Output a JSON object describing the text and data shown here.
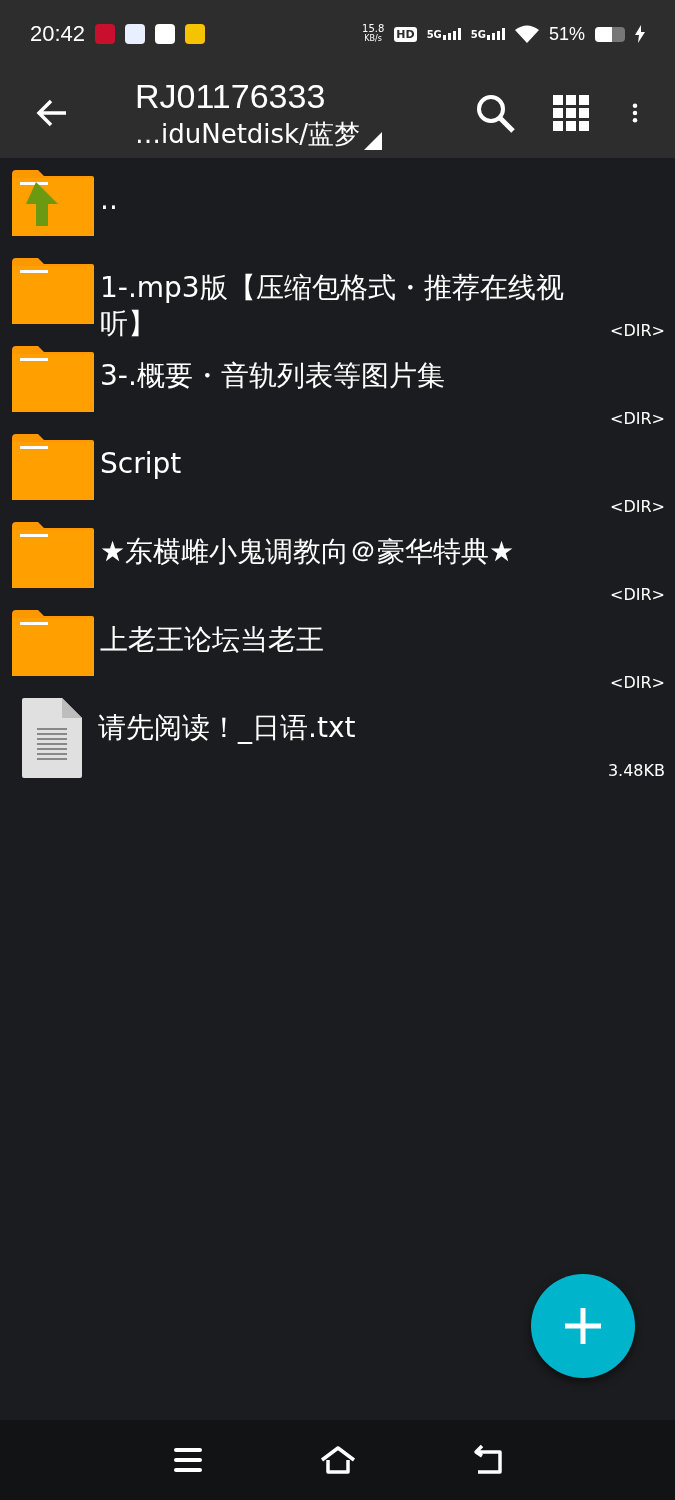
{
  "status_bar": {
    "time": "20:42",
    "net_speed": "15.8",
    "net_unit": "KB/s",
    "hd_label": "HD",
    "sim_labels": [
      "5G",
      "5G"
    ],
    "battery": "51%"
  },
  "toolbar": {
    "title": "RJ01176333",
    "path": "…iduNetdisk/蓝梦"
  },
  "files": [
    {
      "kind": "up",
      "name": ".."
    },
    {
      "kind": "folder",
      "name": "1-.mp3版【压缩包格式・推荐在线视听】",
      "size": "<DIR>"
    },
    {
      "kind": "folder",
      "name": "3-.概要・音轨列表等图片集",
      "size": "<DIR>"
    },
    {
      "kind": "folder",
      "name": "Script",
      "size": "<DIR>"
    },
    {
      "kind": "folder",
      "name": "★东横雌小鬼调教向＠豪华特典★",
      "size": "<DIR>"
    },
    {
      "kind": "folder",
      "name": "上老王论坛当老王",
      "size": "<DIR>"
    },
    {
      "kind": "file",
      "name": "请先阅读！_日语.txt",
      "size": "3.48KB"
    }
  ]
}
